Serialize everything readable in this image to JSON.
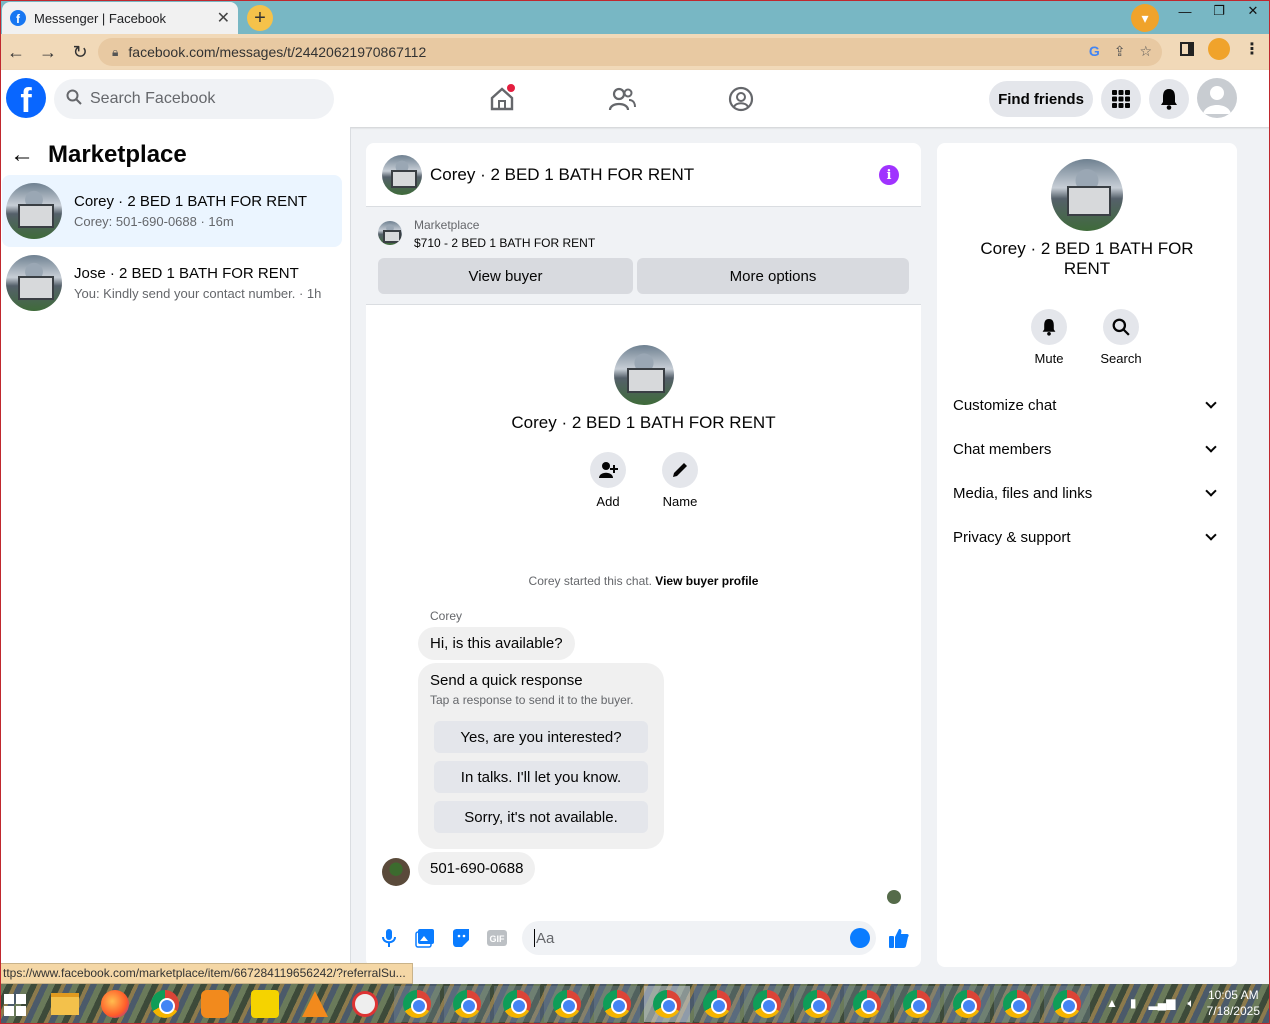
{
  "browser": {
    "tab_title": "Messenger | Facebook",
    "url": "facebook.com/messages/t/24420621970867112",
    "status_url": "ttps://www.facebook.com/marketplace/item/667284119656242/?referralSu..."
  },
  "fb_header": {
    "search_placeholder": "Search Facebook",
    "find_friends": "Find friends"
  },
  "left_panel": {
    "title": "Marketplace",
    "conversations": [
      {
        "title": "Corey · 2 BED 1 BATH FOR RENT",
        "subtitle": "Corey: 501-690-0688 · 16m"
      },
      {
        "title": "Jose · 2 BED 1 BATH FOR RENT",
        "subtitle": "You: Kindly send your contact number. · 1h"
      }
    ]
  },
  "chat": {
    "header_title": "Corey · 2 BED 1 BATH FOR RENT",
    "marketplace_label": "Marketplace",
    "listing": "$710 - 2 BED 1 BATH FOR RENT",
    "view_buyer": "View buyer",
    "more_options": "More options",
    "intro_title": "Corey · 2 BED 1 BATH FOR RENT",
    "add_label": "Add",
    "name_label": "Name",
    "started_text": "Corey started this chat.",
    "view_buyer_profile": "View buyer profile",
    "sender": "Corey",
    "message1": "Hi, is this available?",
    "quick_title": "Send a quick response",
    "quick_sub": "Tap a response to send it to the buyer.",
    "quick_options": [
      "Yes, are you interested?",
      "In talks. I'll let you know.",
      "Sorry, it's not available."
    ],
    "message2": "501-690-0688",
    "composer_placeholder": "Aa"
  },
  "info_panel": {
    "title": "Corey · 2 BED 1 BATH FOR RENT",
    "mute": "Mute",
    "search": "Search",
    "rows": [
      "Customize chat",
      "Chat members",
      "Media, files and links",
      "Privacy & support"
    ]
  },
  "taskbar": {
    "time": "10:05 AM",
    "date": "7/18/2025"
  },
  "colors": {
    "fb_blue": "#0866ff",
    "info_purple": "#a033ff",
    "active_conv": "#ebf5ff"
  }
}
